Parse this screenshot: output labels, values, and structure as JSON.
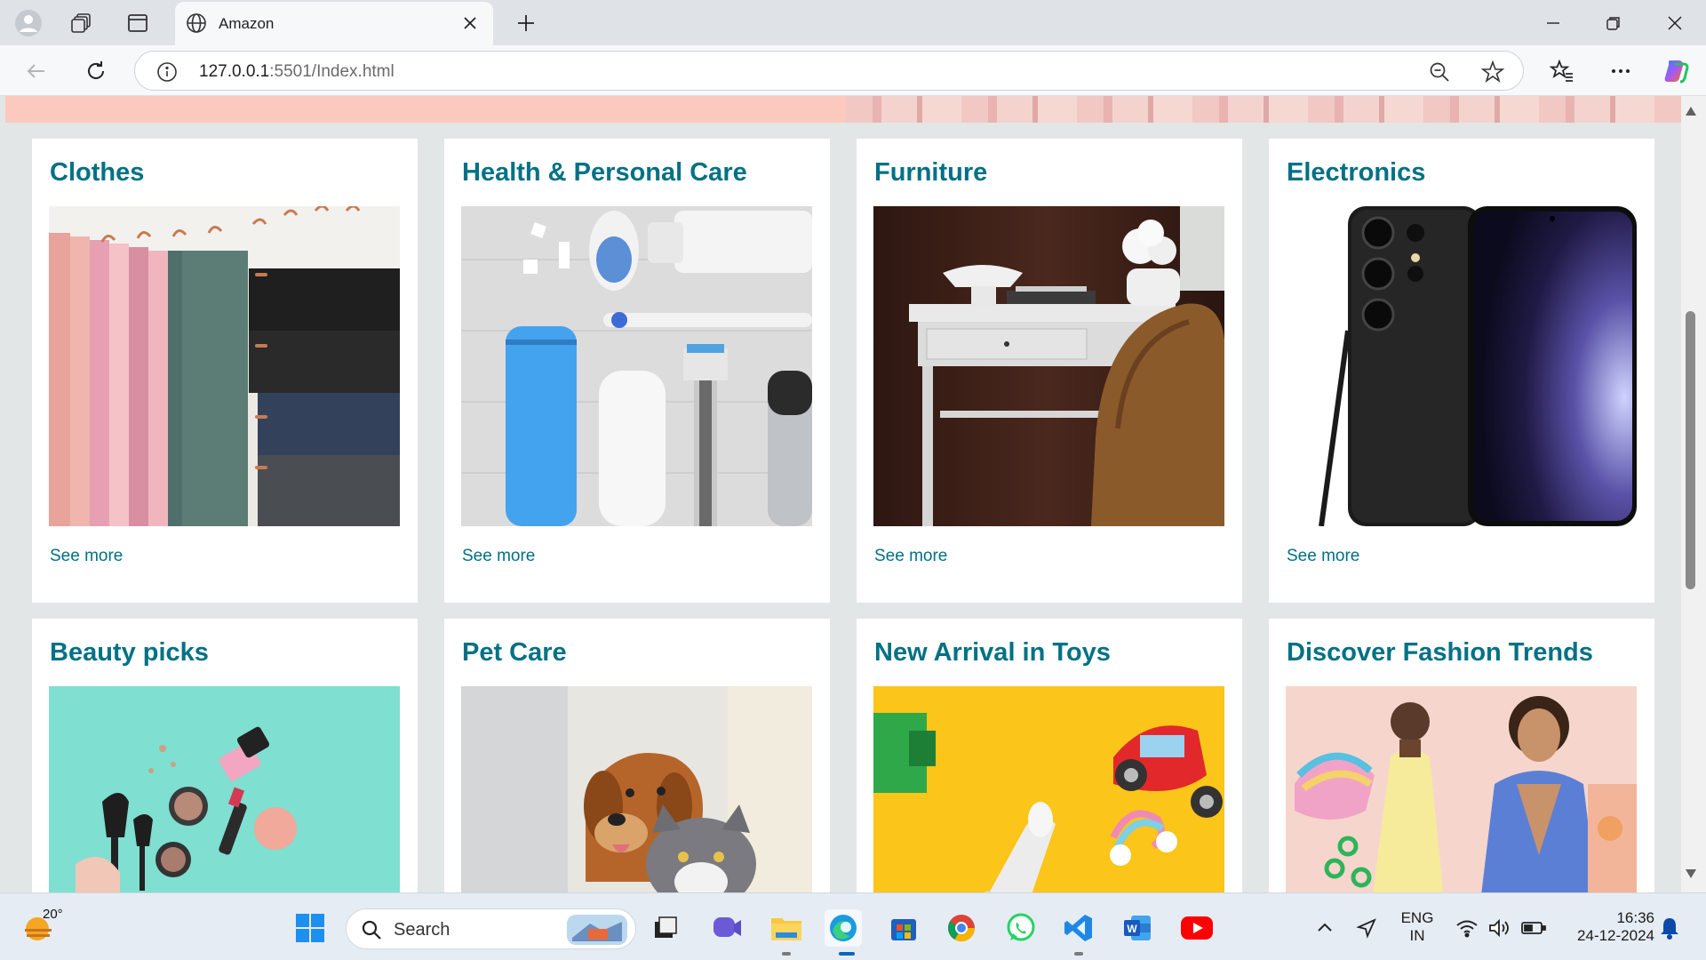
{
  "browser": {
    "tab_title": "Amazon",
    "url_host": "127.0.0.1",
    "url_rest": ":5501/Index.html"
  },
  "categories": [
    {
      "title": "Clothes",
      "link": "See more"
    },
    {
      "title": "Health & Personal Care",
      "link": "See more"
    },
    {
      "title": "Furniture",
      "link": "See more"
    },
    {
      "title": "Electronics",
      "link": "See more"
    },
    {
      "title": "Beauty picks"
    },
    {
      "title": "Pet Care"
    },
    {
      "title": "New Arrival in Toys"
    },
    {
      "title": "Discover Fashion Trends"
    }
  ],
  "taskbar": {
    "weather_temp": "20°",
    "search_label": "Search",
    "lang_primary": "ENG",
    "lang_secondary": "IN",
    "time": "16:36",
    "date": "24-12-2024"
  },
  "colors": {
    "link_teal": "#007185",
    "page_bg": "#e3e6e6"
  }
}
